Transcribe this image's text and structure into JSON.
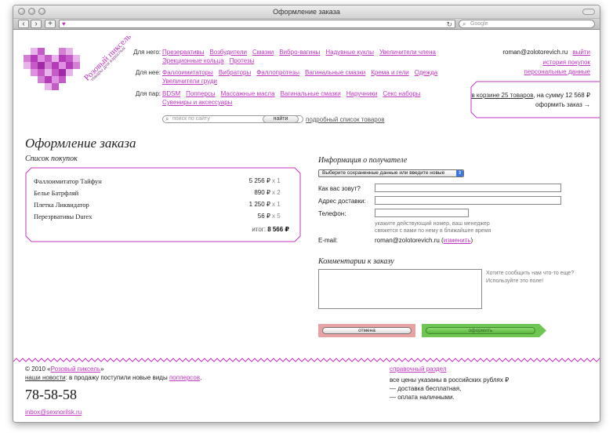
{
  "browser": {
    "window_title": "Оформление заказа",
    "search_placeholder": "Google",
    "add_tab": "+"
  },
  "logo": {
    "name": "Розовый пиксель",
    "tagline": "товары для взрослых"
  },
  "nav": {
    "rows": [
      {
        "label": "Для него:",
        "line1": [
          "Презервативы",
          "Возбудители",
          "Смазки",
          "Вибро-вагины",
          "Надувные куклы",
          "Увеличители члена"
        ],
        "line2": [
          "Эрекционные кольца",
          "Протезы"
        ]
      },
      {
        "label": "Для нее:",
        "line1": [
          "Фаллоимитаторы",
          "Вибраторы",
          "Фаллопротезы",
          "Вагинальные смазки",
          "Крема и гели",
          "Одежда"
        ],
        "line2": [
          "Увеличители груди"
        ]
      },
      {
        "label": "Для пар:",
        "line1": [
          "BDSM",
          "Попперсы",
          "Массажные масла",
          "Вагинальные смазки",
          "Наручники",
          "Секс наборы"
        ],
        "line2": [
          "Сувениры и аксессуары"
        ]
      }
    ]
  },
  "user": {
    "email": "roman@zolotorevich.ru",
    "logout": "выйти",
    "history": "история покупок",
    "personal": "персональные данные"
  },
  "cart": {
    "summary_link": "в корзине 25 товаров",
    "summary_rest": ", на сумму 12 568 ₽",
    "checkout": "оформить заказ →"
  },
  "search": {
    "placeholder": "поиск по сайту",
    "button": "найти",
    "full_list": "подробный список товаров"
  },
  "page_title": "Оформление заказа",
  "order": {
    "heading": "Список покупок",
    "items": [
      {
        "name": "Фаллоимитатор Тайфун",
        "price": "5 256 ₽",
        "qty": "x 1"
      },
      {
        "name": "Белье Батрфляй",
        "price": "890 ₽",
        "qty": "x 2"
      },
      {
        "name": "Плетка Ликвидатор",
        "price": "1 250 ₽",
        "qty": "x 1"
      },
      {
        "name": "Перезрвативы Durex",
        "price": "56 ₽",
        "qty": "x 5"
      }
    ],
    "total_label": "итог:",
    "total_value": "8 566 ₽"
  },
  "recipient": {
    "heading": "Информация о получателе",
    "select_value": "Выберите сохраненные данные или введите новые",
    "name_label": "Как вас зовут?",
    "address_label": "Адрес доставки:",
    "phone_label": "Телефон:",
    "phone_hint_1": "укажите действующий номер, ваш менеджер",
    "phone_hint_2": "свяжется с вами по нему в ближайшее время",
    "email_label": "E-mail:",
    "email_value": "roman@zolotorevich.ru",
    "change_link": "изменить"
  },
  "comment": {
    "heading": "Комментарии к заказу",
    "hint_1": "Хотите сообщить нам что-то еще?",
    "hint_2": "Используйте это поле!"
  },
  "actions": {
    "cancel": "отмена",
    "submit": "оформить"
  },
  "footer": {
    "copyright_prefix": "© 2010 «",
    "copyright_name": "Розовый пиксель",
    "copyright_suffix": "»",
    "news_link": "наши новости",
    "news_text": ": в продажу поступили новые виды ",
    "news_item": "попперсов",
    "news_end": ".",
    "phone": "78-58-58",
    "email": "inbox@sexnorilsk.ru",
    "help_link": "справочный раздел",
    "note_1": "все цены указаны в российских рублях ₽",
    "note_2": "— доставка бесплатная,",
    "note_3": "— оплата наличными."
  },
  "colors": {
    "brand_pink": "#c236c4",
    "cancel_bg": "#e7a3a3",
    "submit_bg": "#6fc653"
  }
}
